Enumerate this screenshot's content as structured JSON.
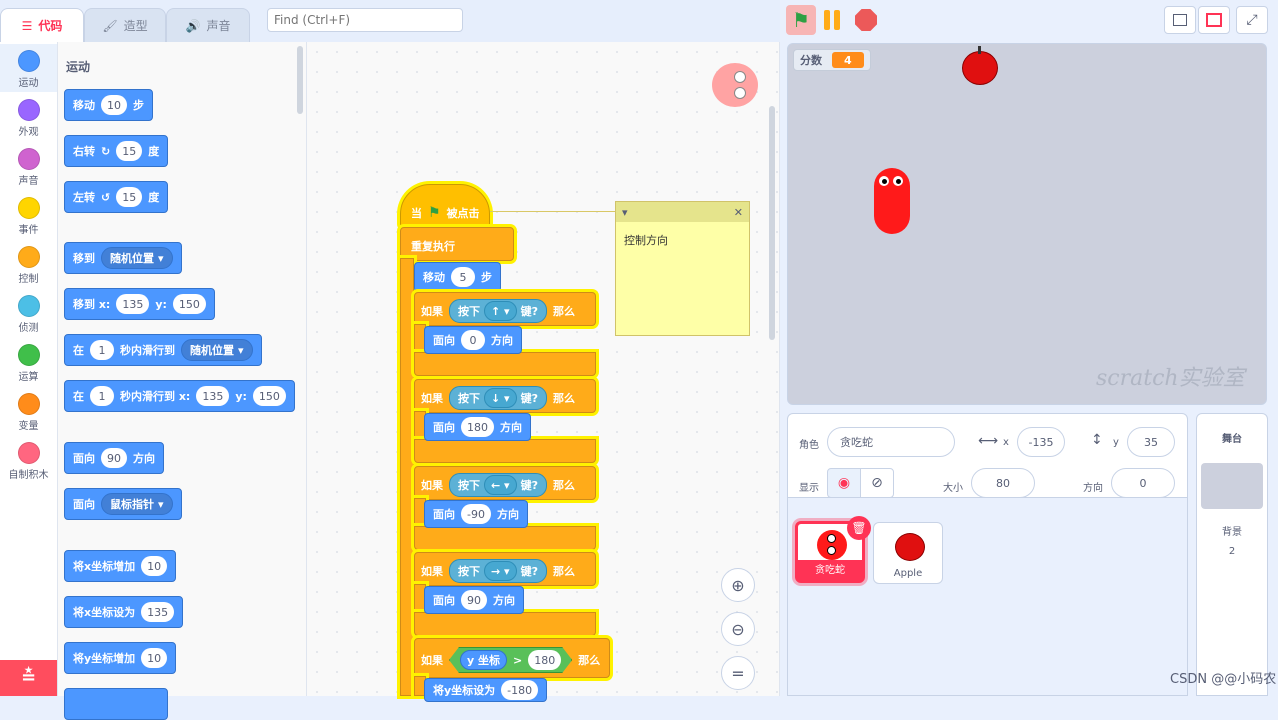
{
  "tabs": {
    "code": "代码",
    "costumes": "造型",
    "sounds": "声音"
  },
  "find": {
    "placeholder": "Find (Ctrl+F)"
  },
  "categories": [
    {
      "label": "运动",
      "color": "#4c97ff"
    },
    {
      "label": "外观",
      "color": "#9966ff"
    },
    {
      "label": "声音",
      "color": "#cf63cf"
    },
    {
      "label": "事件",
      "color": "#ffd500"
    },
    {
      "label": "控制",
      "color": "#ffab19"
    },
    {
      "label": "侦测",
      "color": "#4cbfe6"
    },
    {
      "label": "运算",
      "color": "#40bf4a"
    },
    {
      "label": "变量",
      "color": "#ff8c1a"
    },
    {
      "label": "自制积木",
      "color": "#ff6680"
    }
  ],
  "palette": {
    "title": "运动",
    "move": {
      "a": "移动",
      "v": "10",
      "b": "步"
    },
    "turn_right": {
      "a": "右转",
      "v": "15",
      "b": "度"
    },
    "turn_left": {
      "a": "左转",
      "v": "15",
      "b": "度"
    },
    "goto": {
      "a": "移到",
      "dd": "随机位置"
    },
    "goto_xy": {
      "a": "移到 x:",
      "x": "135",
      "b": "y:",
      "y": "150"
    },
    "glide": {
      "a": "在",
      "v": "1",
      "b": "秒内滑行到",
      "dd": "随机位置"
    },
    "glide_xy": {
      "a": "在",
      "v": "1",
      "b": "秒内滑行到 x:",
      "x": "135",
      "c": "y:",
      "y": "150"
    },
    "point": {
      "a": "面向",
      "v": "90",
      "b": "方向"
    },
    "point_towards": {
      "a": "面向",
      "dd": "鼠标指针"
    },
    "change_x": {
      "a": "将x坐标增加",
      "v": "10"
    },
    "set_x": {
      "a": "将x坐标设为",
      "v": "135"
    },
    "change_y": {
      "a": "将y坐标增加",
      "v": "10"
    }
  },
  "script": {
    "hat": {
      "a": "当",
      "b": "被点击"
    },
    "forever": "重复执行",
    "move": {
      "a": "移动",
      "v": "5",
      "b": "步"
    },
    "if_label": "如果",
    "then_label": "那么",
    "press": "按下",
    "key_q": "键?",
    "point_label": "面向",
    "dir_label": "方向",
    "cases": [
      {
        "key": "↑",
        "dir": "0"
      },
      {
        "key": "↓",
        "dir": "180"
      },
      {
        "key": "←",
        "dir": "-90"
      },
      {
        "key": "→",
        "dir": "90"
      }
    ],
    "cond": {
      "var": "y 坐标",
      "op": ">",
      "v": "180"
    },
    "set_y": {
      "a": "将y坐标设为",
      "v": "-180"
    }
  },
  "comment": {
    "text": "控制方向"
  },
  "stage": {
    "score_label": "分数",
    "score_value": "4",
    "watermark": "scratch实验室"
  },
  "info": {
    "sprite_label": "角色",
    "sprite_name": "贪吃蛇",
    "x_label": "x",
    "x": "-135",
    "y_label": "y",
    "y": "35",
    "show_label": "显示",
    "size_label": "大小",
    "size": "80",
    "dir_label": "方向",
    "dir": "0"
  },
  "sprites": [
    {
      "name": "贪吃蛇"
    },
    {
      "name": "Apple"
    }
  ],
  "stagepanel": {
    "title": "舞台",
    "bg_label": "背景",
    "bg_count": "2"
  },
  "footer": {
    "csdn": "CSDN @@小码农"
  },
  "colors": {
    "motion": "#4c97ff",
    "control": "#ffab19",
    "sensing": "#5cb1d6",
    "operator": "#59c059",
    "accent": "#ff3355"
  }
}
